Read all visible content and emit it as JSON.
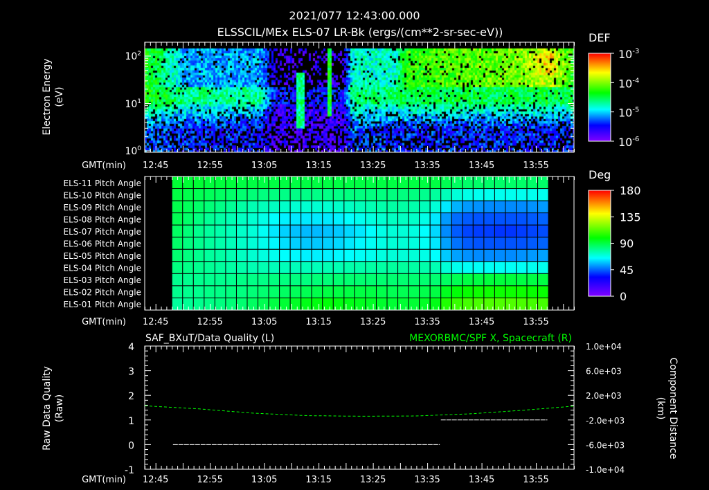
{
  "header": {
    "time": "2021/077 12:43:00.000",
    "title": "ELSSCIL/MEx ELS-07 LR-Bk  (ergs/(cm**2-sr-sec-eV))"
  },
  "time_axis": {
    "label": "GMT(min)",
    "start": "12:43",
    "span_min": 79,
    "ticks": [
      "12:45",
      "12:55",
      "13:05",
      "13:15",
      "13:25",
      "13:35",
      "13:45",
      "13:55"
    ],
    "tick_offsets_min": [
      2,
      12,
      22,
      32,
      42,
      52,
      62,
      72
    ]
  },
  "chart_data": [
    {
      "type": "heatmap",
      "name": "electron-spectrogram",
      "ylabel": "Electron Energy",
      "yunit": "(eV)",
      "yscale": "log",
      "ylim": [
        1,
        195
      ],
      "yticks": [
        {
          "base": "10",
          "exp": "2"
        },
        {
          "base": "10",
          "exp": "1"
        },
        {
          "base": "10",
          "exp": "0"
        }
      ],
      "colorbar": {
        "label": "DEF",
        "scale": "log",
        "range": [
          1e-06,
          0.001
        ],
        "ticks": [
          {
            "base": "10",
            "exp": "-3"
          },
          {
            "base": "10",
            "exp": "-4"
          },
          {
            "base": "10",
            "exp": "-5"
          },
          {
            "base": "10",
            "exp": "-6"
          }
        ]
      },
      "profile_note_units": "level 0..1 maps log10 DEF -6..-3; t in minutes after 12:43",
      "profile": [
        {
          "t": 0,
          "hi": 0.56,
          "mid": 0.5,
          "lo": 0.25
        },
        {
          "t": 4,
          "hi": 0.45,
          "mid": 0.45,
          "lo": 0.22
        },
        {
          "t": 7,
          "hi": 0.3,
          "mid": 0.4,
          "lo": 0.2
        },
        {
          "t": 21,
          "hi": 0.3,
          "mid": 0.38,
          "lo": 0.18
        },
        {
          "t": 24,
          "hi": 0.08,
          "mid": 0.12,
          "lo": 0.08
        },
        {
          "t": 36.5,
          "hi": 0.08,
          "mid": 0.12,
          "lo": 0.08
        },
        {
          "t": 38,
          "hi": 0.4,
          "mid": 0.42,
          "lo": 0.24
        },
        {
          "t": 46,
          "hi": 0.4,
          "mid": 0.42,
          "lo": 0.2
        },
        {
          "t": 48,
          "hi": 0.58,
          "mid": 0.45,
          "lo": 0.2
        },
        {
          "t": 70,
          "hi": 0.66,
          "mid": 0.45,
          "lo": 0.2
        },
        {
          "t": 74,
          "hi": 0.74,
          "mid": 0.46,
          "lo": 0.2
        },
        {
          "t": 79,
          "hi": 0.55,
          "mid": 0.45,
          "lo": 0.2
        }
      ],
      "spikes": [
        {
          "t": 28.5,
          "width": 1.2,
          "level": 0.45,
          "min_logE": 0.5,
          "max_logE": 1.7
        },
        {
          "t": 33.8,
          "width": 1.0,
          "level": 0.52,
          "min_logE": 0.75,
          "max_logE": 2.2
        }
      ]
    },
    {
      "type": "heatmap",
      "name": "pitch-angle-grid",
      "rows": [
        "ELS-11 Pitch Angle",
        "ELS-10 Pitch Angle",
        "ELS-09 Pitch Angle",
        "ELS-08 Pitch Angle",
        "ELS-07 Pitch Angle",
        "ELS-06 Pitch Angle",
        "ELS-05 Pitch Angle",
        "ELS-04 Pitch Angle",
        "ELS-03 Pitch Angle",
        "ELS-02 Pitch Angle",
        "ELS-01 Pitch Angle"
      ],
      "col_start_min": 5,
      "col_step_min": 1.98,
      "colorbar": {
        "label": "Deg",
        "range": [
          0,
          180
        ],
        "ticks": [
          "180",
          "135",
          "90",
          "45",
          "0"
        ]
      },
      "values": [
        [
          92,
          92,
          92,
          91,
          91,
          91,
          90,
          90,
          90,
          90,
          90,
          90,
          90,
          90,
          90,
          90,
          90,
          90,
          90,
          90,
          90,
          90,
          90,
          90,
          90,
          88,
          86,
          85,
          85,
          85,
          85,
          85,
          85,
          85,
          85
        ],
        [
          90,
          89,
          88,
          87,
          86,
          85,
          84,
          83,
          82,
          82,
          81,
          81,
          81,
          81,
          81,
          81,
          82,
          82,
          82,
          82,
          82,
          82,
          82,
          80,
          78,
          74,
          70,
          68,
          67,
          67,
          67,
          67,
          67,
          67,
          67
        ],
        [
          89,
          87,
          85,
          83,
          81,
          79,
          77,
          75,
          74,
          73,
          72,
          71,
          71,
          71,
          71,
          72,
          73,
          74,
          75,
          76,
          77,
          77,
          76,
          74,
          70,
          62,
          55,
          52,
          51,
          50,
          50,
          50,
          50,
          51,
          52
        ],
        [
          88,
          85,
          82,
          79,
          77,
          75,
          73,
          71,
          68,
          65,
          63,
          62,
          62,
          62,
          62,
          63,
          65,
          67,
          69,
          71,
          73,
          73,
          72,
          68,
          62,
          52,
          46,
          44,
          43,
          43,
          43,
          43,
          43,
          44,
          45
        ],
        [
          86,
          83,
          80,
          78,
          76,
          74,
          72,
          70,
          66,
          62,
          59,
          57,
          56,
          56,
          57,
          58,
          60,
          62,
          65,
          68,
          70,
          70,
          69,
          65,
          60,
          50,
          44,
          41,
          40,
          40,
          39,
          39,
          40,
          41,
          42
        ],
        [
          85,
          82,
          80,
          78,
          76,
          74,
          72,
          70,
          67,
          64,
          61,
          59,
          58,
          58,
          59,
          60,
          62,
          64,
          66,
          68,
          70,
          70,
          69,
          66,
          62,
          53,
          47,
          44,
          43,
          43,
          43,
          43,
          43,
          44,
          45
        ],
        [
          84,
          82,
          80,
          78,
          77,
          75,
          73,
          71,
          69,
          67,
          65,
          64,
          63,
          63,
          63,
          64,
          65,
          66,
          67,
          69,
          70,
          70,
          70,
          68,
          65,
          58,
          53,
          51,
          50,
          50,
          50,
          50,
          51,
          52,
          53
        ],
        [
          82,
          81,
          80,
          79,
          78,
          77,
          76,
          75,
          75,
          74,
          74,
          74,
          74,
          74,
          75,
          75,
          76,
          76,
          77,
          77,
          78,
          78,
          77,
          76,
          75,
          70,
          67,
          66,
          66,
          66,
          66,
          66,
          66,
          67,
          67
        ],
        [
          80,
          80,
          80,
          80,
          80,
          80,
          81,
          81,
          81,
          82,
          82,
          82,
          82,
          83,
          83,
          84,
          84,
          84,
          84,
          84,
          84,
          84,
          84,
          84,
          84,
          86,
          88,
          90,
          90,
          91,
          91,
          91,
          90,
          90,
          90
        ],
        [
          80,
          80,
          80,
          81,
          81,
          82,
          82,
          83,
          84,
          85,
          86,
          87,
          88,
          89,
          90,
          90,
          90,
          90,
          90,
          89,
          88,
          88,
          88,
          89,
          90,
          95,
          98,
          100,
          101,
          101,
          101,
          101,
          101,
          100,
          100
        ],
        [
          78,
          79,
          80,
          81,
          82,
          83,
          84,
          86,
          88,
          90,
          92,
          94,
          96,
          97,
          98,
          97,
          96,
          95,
          94,
          93,
          92,
          92,
          92,
          94,
          96,
          104,
          108,
          110,
          111,
          112,
          112,
          112,
          111,
          110,
          110
        ]
      ]
    },
    {
      "type": "line",
      "name": "quality-and-position",
      "left_title": "SAF_BXuT/Data Quality (L)",
      "right_title": "MEXORBMC/SPF X, Spacecraft (R)",
      "ylabel_left": "Raw Data Quality",
      "ylabel_left_unit": "(Raw)",
      "ylabel_right": "Component Distance",
      "ylabel_right_unit": "(km)",
      "ylim_left": [
        -1,
        4
      ],
      "yticks_left": [
        "4",
        "3",
        "2",
        "1",
        "0",
        "-1"
      ],
      "ylim_right": [
        -10000,
        10000
      ],
      "yticks_right": [
        "1.0e+04",
        "6.0e+03",
        "2.0e+03",
        "-2.0e+03",
        "-6.0e+03",
        "-1.0e+04"
      ],
      "series": [
        {
          "name": "Data Quality",
          "color": "#ffffff",
          "segments": [
            {
              "t0": 5.2,
              "t1": 54.3,
              "value": 0
            },
            {
              "t0": 54.5,
              "t1": 74.1,
              "value": 1
            }
          ]
        },
        {
          "name": "SPF X",
          "color": "#00ff00",
          "axis": "right",
          "t": [
            0,
            10,
            20,
            30,
            40,
            50,
            60,
            70,
            79
          ],
          "values": [
            300,
            -200,
            -900,
            -1300,
            -1400,
            -1350,
            -1000,
            -400,
            250
          ]
        }
      ]
    }
  ]
}
